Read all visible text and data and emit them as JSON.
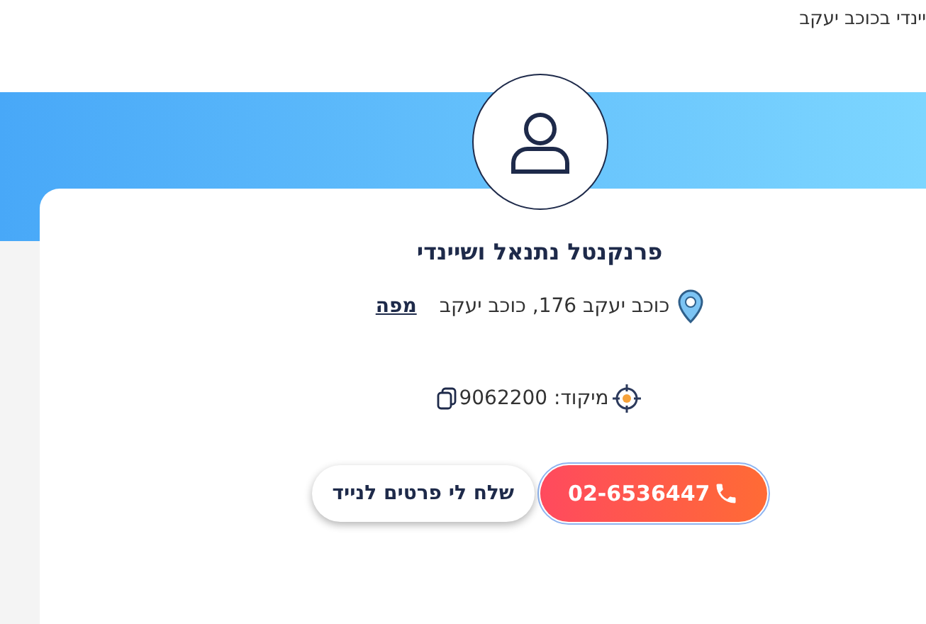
{
  "header_text": "יינדי בכוכב יעקב",
  "business": {
    "name": "פרנקנטל נתנאל ושיינדי",
    "address": "כוכב יעקב 176, כוכב יעקב",
    "map_link": "מפה",
    "zip": "מיקוד: 9062200"
  },
  "buttons": [
    {
      "kind": "phone",
      "label": "02-6536447",
      "focused": true
    },
    {
      "kind": "sms",
      "label": "שלח לי פרטים לנייד",
      "focused": false
    }
  ]
}
